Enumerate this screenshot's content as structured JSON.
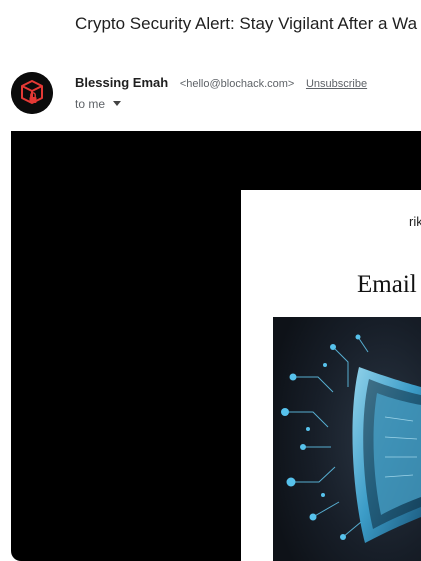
{
  "email": {
    "subject": "Crypto Security Alert: Stay Vigilant After a Wa",
    "sender": {
      "name": "Blessing Emah",
      "address": "<hello@blochack.com>",
      "unsubscribe_label": "Unsubscribe"
    },
    "recipient_label": "to me"
  },
  "content": {
    "card_top_text": "rik",
    "card_heading": "Email",
    "hero_image_icon": "cyber-security-shield-illustration"
  },
  "colors": {
    "body_background": "#000000",
    "avatar_background": "#0b0b0b",
    "avatar_accent": "#e53935",
    "hero_glow": "#4fc3f7"
  }
}
